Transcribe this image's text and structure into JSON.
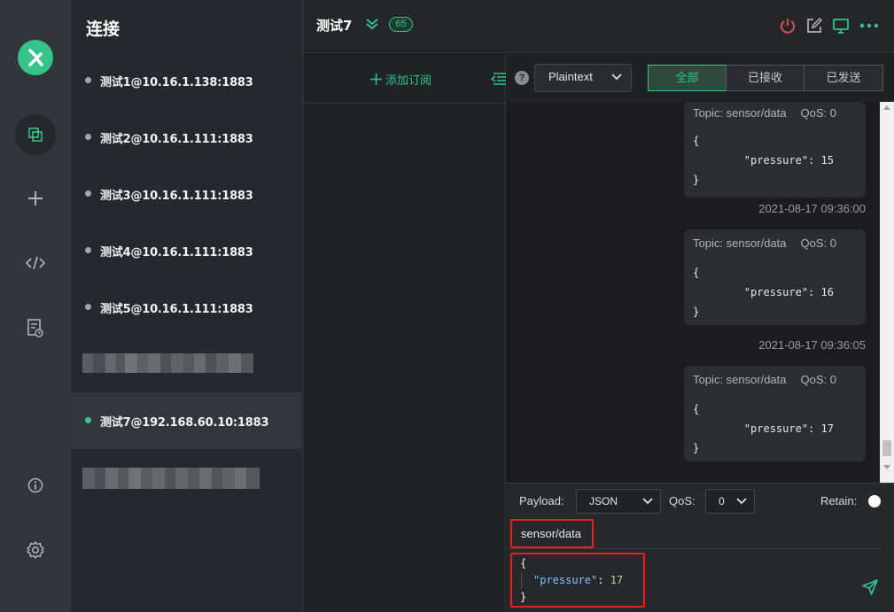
{
  "sidebar": {
    "title": "连接",
    "connections": [
      {
        "label": "测试1@10.16.1.138:1883",
        "status": "offline"
      },
      {
        "label": "测试2@10.16.1.111:1883",
        "status": "offline"
      },
      {
        "label": "测试3@10.16.1.111:1883",
        "status": "offline"
      },
      {
        "label": "测试4@10.16.1.111:1883",
        "status": "offline"
      },
      {
        "label": "测试5@10.16.1.111:1883",
        "status": "offline"
      },
      {
        "label": "",
        "status": "redacted"
      },
      {
        "label": "测试7@192.168.60.10:1883",
        "status": "online"
      },
      {
        "label": "",
        "status": "redacted"
      }
    ]
  },
  "rail": {
    "icons": [
      "logo-icon",
      "connections-icon",
      "add-icon",
      "script-icon",
      "log-icon",
      "info-icon",
      "settings-icon"
    ]
  },
  "header": {
    "connection_name": "测试7",
    "message_count": "65",
    "actions": [
      "power-icon",
      "edit-icon",
      "monitor-icon",
      "more-icon"
    ]
  },
  "subscriptions": {
    "add_label": "添加订阅"
  },
  "filter": {
    "format": "Plaintext",
    "tabs": [
      "全部",
      "已接收",
      "已发送"
    ],
    "active_tab": "全部"
  },
  "messages": [
    {
      "topic_label": "Topic: sensor/data",
      "qos_label": "QoS: 0",
      "line1": "{",
      "line2": "        \"pressure\": 15",
      "line3": "}",
      "timestamp": "2021-08-17 09:36:00"
    },
    {
      "topic_label": "Topic: sensor/data",
      "qos_label": "QoS: 0",
      "line1": "{",
      "line2": "        \"pressure\": 16",
      "line3": "}",
      "timestamp": "2021-08-17 09:36:05"
    },
    {
      "topic_label": "Topic: sensor/data",
      "qos_label": "QoS: 0",
      "line1": "{",
      "line2": "        \"pressure\": 17",
      "line3": "}"
    }
  ],
  "composer": {
    "payload_label": "Payload:",
    "payload_format": "JSON",
    "qos_label": "QoS:",
    "qos_value": "0",
    "retain_label": "Retain:",
    "topic": "sensor/data",
    "payload_open": "{",
    "payload_key": "\"pressure\"",
    "payload_colon": ": ",
    "payload_value": "17",
    "payload_close": "}"
  },
  "colors": {
    "accent": "#34c388",
    "highlight": "#e0241d",
    "power": "#e0524d"
  }
}
